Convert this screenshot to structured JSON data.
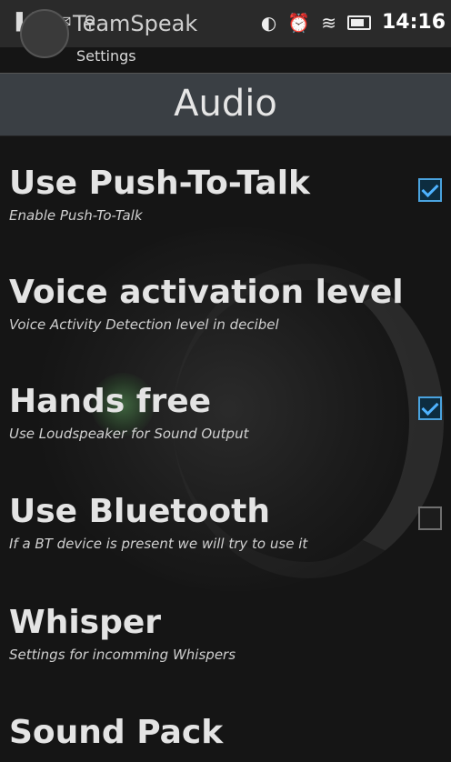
{
  "status_bar": {
    "time": "14:16",
    "left_icons": [
      "signal-icon",
      "message-icon",
      "usb-icon"
    ],
    "right_icons": [
      "volume-icon",
      "alarm-icon",
      "wifi-icon",
      "battery-icon"
    ]
  },
  "app": {
    "title": "TeamSpeak",
    "subtitle": "Settings"
  },
  "section": {
    "title": "Audio"
  },
  "preferences": [
    {
      "title": "Use Push-To-Talk",
      "summary": "Enable Push-To-Talk",
      "checkbox": true,
      "checked": true
    },
    {
      "title": "Voice activation level",
      "summary": "Voice Activity Detection level in decibel",
      "checkbox": false
    },
    {
      "title": "Hands free",
      "summary": "Use Loudspeaker for Sound Output",
      "checkbox": true,
      "checked": true
    },
    {
      "title": "Use Bluetooth",
      "summary": "If a BT device is present we will try to use it",
      "checkbox": true,
      "checked": false
    },
    {
      "title": "Whisper",
      "summary": "Settings for incomming Whispers",
      "checkbox": false
    },
    {
      "title": "Sound Pack",
      "summary": "",
      "checkbox": false
    }
  ],
  "colors": {
    "background": "#151515",
    "header": "#3a3f44",
    "accent": "#4fb3ff"
  }
}
